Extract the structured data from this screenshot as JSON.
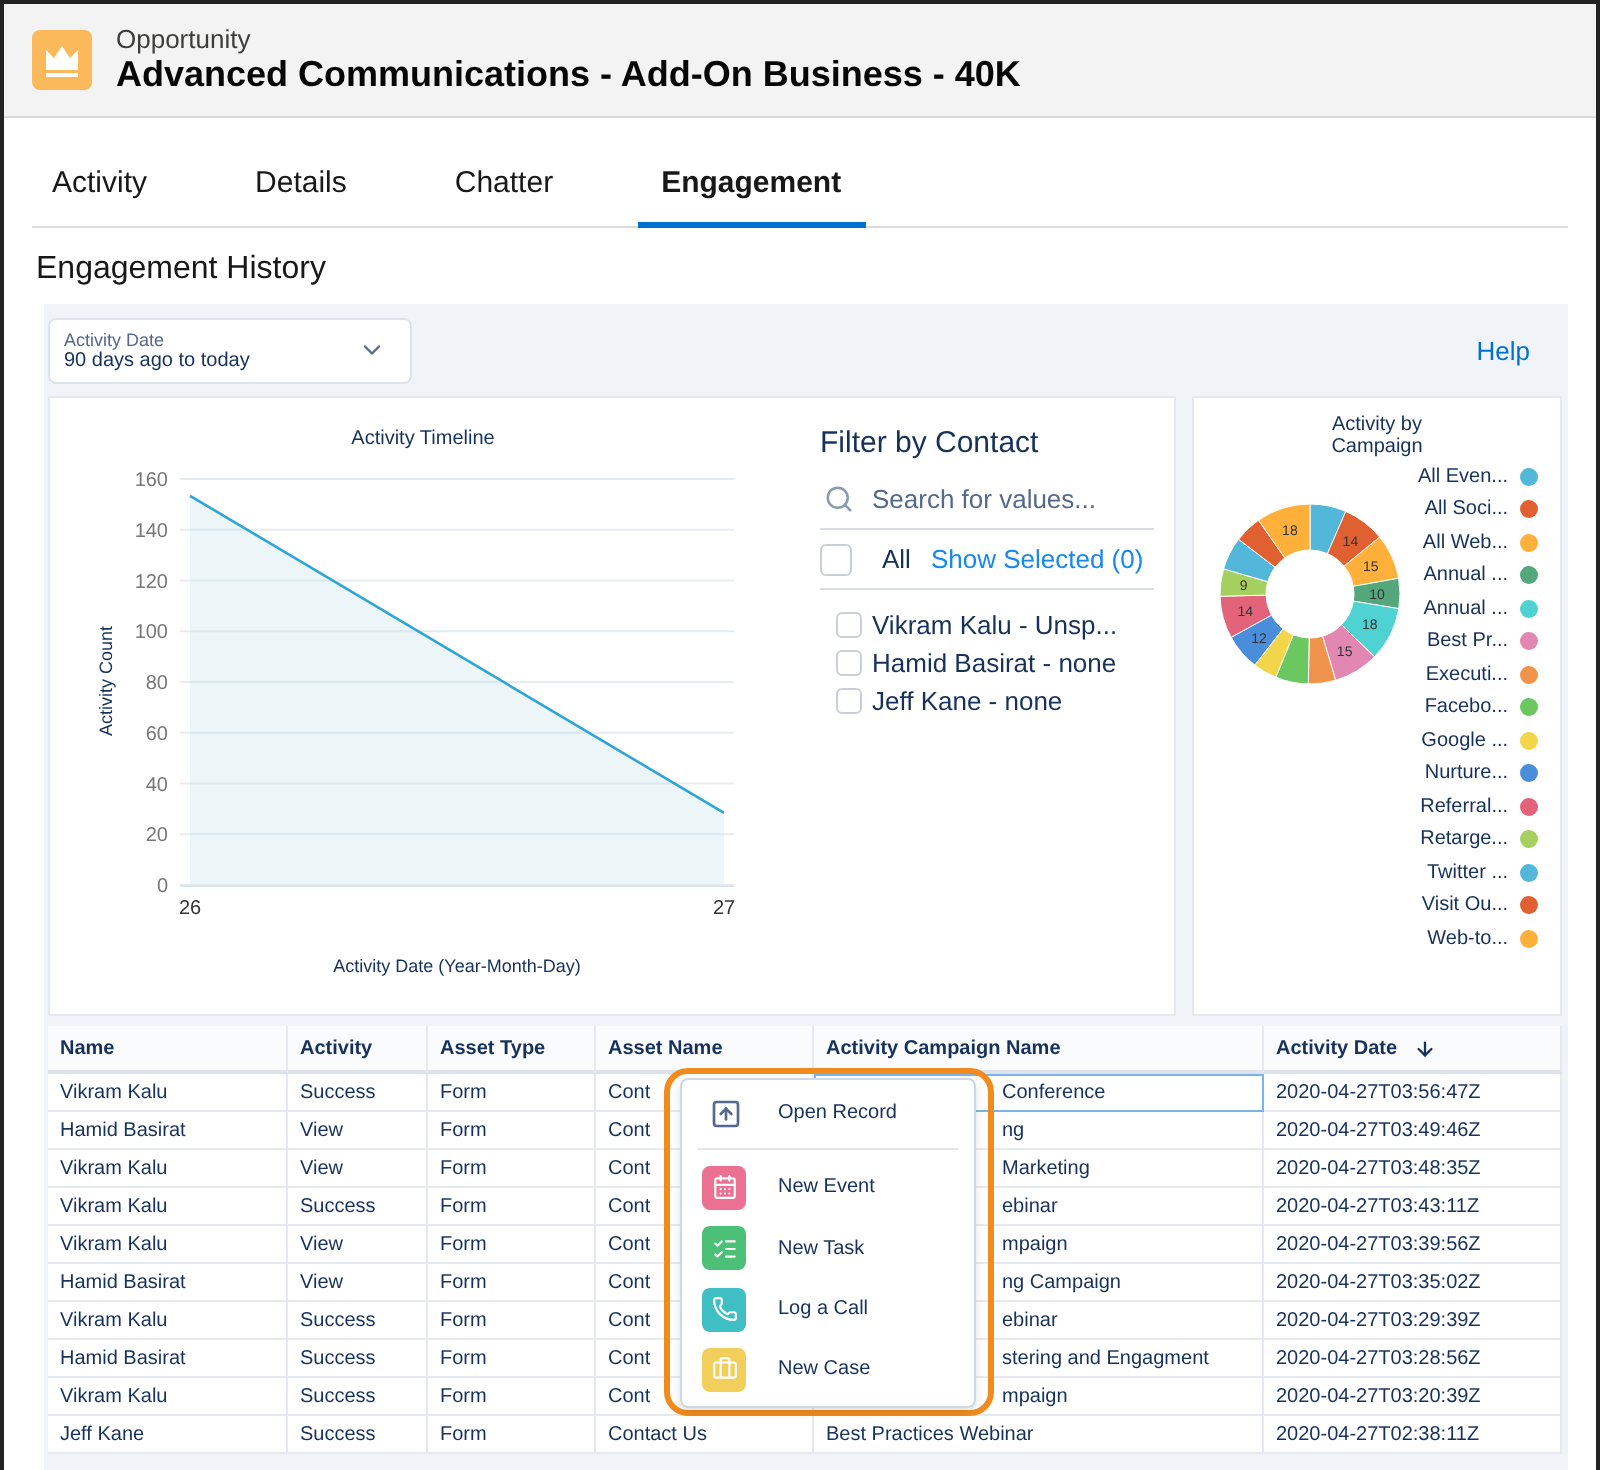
{
  "header": {
    "object_type": "Opportunity",
    "title": "Advanced Communications - Add-On Business - 40K"
  },
  "tabs": [
    {
      "label": "Activity",
      "selected": false
    },
    {
      "label": "Details",
      "selected": false
    },
    {
      "label": "Chatter",
      "selected": false
    },
    {
      "label": "Engagement",
      "selected": true
    }
  ],
  "section_title": "Engagement History",
  "date_filter": {
    "label": "Activity Date",
    "value": "90 days ago to today"
  },
  "help_link": "Help",
  "timeline": {
    "chart_data": {
      "type": "area",
      "title": "Activity Timeline",
      "xlabel": "Activity Date (Year-Month-Day)",
      "ylabel": "Activity Count",
      "categories": [
        "26",
        "27"
      ],
      "series": [
        {
          "color": "#2da5d6",
          "values": [
            153,
            28
          ]
        }
      ],
      "ylim": [
        0,
        160
      ],
      "yticks": [
        0,
        20,
        40,
        60,
        80,
        100,
        120,
        140,
        160
      ]
    }
  },
  "contact_filter": {
    "title": "Filter by Contact",
    "search_placeholder": "Search for values...",
    "all_label": "All",
    "all_checked": false,
    "show_selected": "Show Selected (0)",
    "contacts": [
      {
        "label": "Vikram Kalu - Unsp...",
        "checked": false
      },
      {
        "label": "Hamid Basirat - none",
        "checked": false
      },
      {
        "label": "Jeff Kane - none",
        "checked": false
      }
    ]
  },
  "campaign_chart": {
    "chart_data": {
      "type": "donut",
      "title": "Activity by Campaign",
      "categories": [
        "All Even...",
        "All Soci...",
        "All Web...",
        "Annual ...",
        "Annual ...",
        "Best Pr...",
        "Executi...",
        "Facebo...",
        "Google ...",
        "Nurture...",
        "Referral...",
        "Retarge...",
        "Twitter ...",
        "Visit Ou...",
        "Web-to..."
      ],
      "series": [
        {
          "values": [
            6.5,
            7.6,
            8.1,
            5.4,
            9.7,
            8.1,
            4.9,
            5.9,
            4.3,
            6.5,
            7.6,
            4.9,
            5.9,
            4.9,
            9.7
          ]
        }
      ],
      "colors": [
        "#52b7d8",
        "#e16032",
        "#ffb03b",
        "#54a77b",
        "#4fd2d2",
        "#e287b2",
        "#f0944d",
        "#6bc760",
        "#f3d54a",
        "#4a8ddb",
        "#e3647a",
        "#a5cf5e",
        "#52b7d8",
        "#e16032",
        "#ffb03b"
      ],
      "value_labels": [
        null,
        "14",
        "15",
        "10",
        "18",
        "15",
        null,
        null,
        null,
        "12",
        "14",
        "9",
        null,
        null,
        "18"
      ]
    }
  },
  "table": {
    "columns": [
      {
        "label": "Name",
        "sorted": false
      },
      {
        "label": "Activity",
        "sorted": false
      },
      {
        "label": "Asset Type",
        "sorted": false
      },
      {
        "label": "Asset Name",
        "sorted": false
      },
      {
        "label": "Activity Campaign Name",
        "sorted": false
      },
      {
        "label": "Activity Date",
        "sorted": true
      }
    ],
    "rows": [
      {
        "name": "Vikram Kalu",
        "activity": "Success",
        "asset_type": "Form",
        "asset_name": "Cont",
        "campaign": "Conference",
        "date": "2020-04-27T03:56:47Z",
        "covered": true,
        "focused": true
      },
      {
        "name": "Hamid Basirat",
        "activity": "View",
        "asset_type": "Form",
        "asset_name": "Cont",
        "campaign": "ng",
        "date": "2020-04-27T03:49:46Z",
        "covered": true,
        "focused": false
      },
      {
        "name": "Vikram Kalu",
        "activity": "View",
        "asset_type": "Form",
        "asset_name": "Cont",
        "campaign": "Marketing",
        "date": "2020-04-27T03:48:35Z",
        "covered": true,
        "focused": false
      },
      {
        "name": "Vikram Kalu",
        "activity": "Success",
        "asset_type": "Form",
        "asset_name": "Cont",
        "campaign": "ebinar",
        "date": "2020-04-27T03:43:11Z",
        "covered": true,
        "focused": false
      },
      {
        "name": "Vikram Kalu",
        "activity": "View",
        "asset_type": "Form",
        "asset_name": "Cont",
        "campaign": "mpaign",
        "date": "2020-04-27T03:39:56Z",
        "covered": true,
        "focused": false
      },
      {
        "name": "Hamid Basirat",
        "activity": "View",
        "asset_type": "Form",
        "asset_name": "Cont",
        "campaign": "ng Campaign",
        "date": "2020-04-27T03:35:02Z",
        "covered": true,
        "focused": false
      },
      {
        "name": "Vikram Kalu",
        "activity": "Success",
        "asset_type": "Form",
        "asset_name": "Cont",
        "campaign": "ebinar",
        "date": "2020-04-27T03:29:39Z",
        "covered": true,
        "focused": false
      },
      {
        "name": "Hamid Basirat",
        "activity": "Success",
        "asset_type": "Form",
        "asset_name": "Cont",
        "campaign": "stering and Engagment",
        "date": "2020-04-27T03:28:56Z",
        "covered": true,
        "focused": false
      },
      {
        "name": "Vikram Kalu",
        "activity": "Success",
        "asset_type": "Form",
        "asset_name": "Cont",
        "campaign": "mpaign",
        "date": "2020-04-27T03:20:39Z",
        "covered": true,
        "focused": false
      },
      {
        "name": "Jeff Kane",
        "activity": "Success",
        "asset_type": "Form",
        "asset_name": "Contact Us",
        "campaign": "Best Practices Webinar",
        "date": "2020-04-27T02:38:11Z",
        "covered": false,
        "focused": false
      }
    ]
  },
  "context_menu": {
    "items": [
      {
        "kind": "open",
        "label": "Open Record"
      },
      {
        "kind": "event",
        "label": "New Event"
      },
      {
        "kind": "task",
        "label": "New Task"
      },
      {
        "kind": "call",
        "label": "Log a Call"
      },
      {
        "kind": "case",
        "label": "New Case"
      }
    ]
  }
}
